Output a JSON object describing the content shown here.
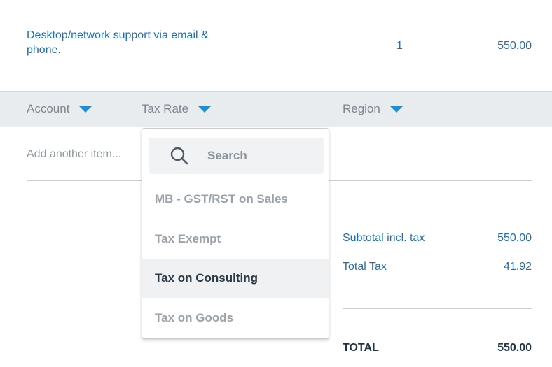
{
  "line_item": {
    "description": "Desktop/network support via email & phone.",
    "quantity": "1",
    "amount": "550.00"
  },
  "columns": {
    "account": "Account",
    "tax_rate": "Tax Rate",
    "region": "Region"
  },
  "add_item": {
    "placeholder": "Add another item..."
  },
  "totals": {
    "subtotal_label": "Subtotal incl. tax",
    "subtotal_value": "550.00",
    "tax_label": "Total Tax",
    "tax_value": "41.92",
    "total_label": "TOTAL",
    "total_value": "550.00"
  },
  "tax_dropdown": {
    "search_placeholder": "Search",
    "options": [
      {
        "label": "MB - GST/RST on Sales"
      },
      {
        "label": "Tax Exempt"
      },
      {
        "label": "Tax on Consulting"
      },
      {
        "label": "Tax on Goods"
      }
    ],
    "selected_label": "Tax on Consulting"
  },
  "colors": {
    "link_blue": "#1f6fb2",
    "caret_blue": "#1c8ed6",
    "header_bg": "#e9ecee",
    "total_text": "#1e3549"
  },
  "icons": {
    "search": "search-icon",
    "caret": "caret-down-icon"
  }
}
